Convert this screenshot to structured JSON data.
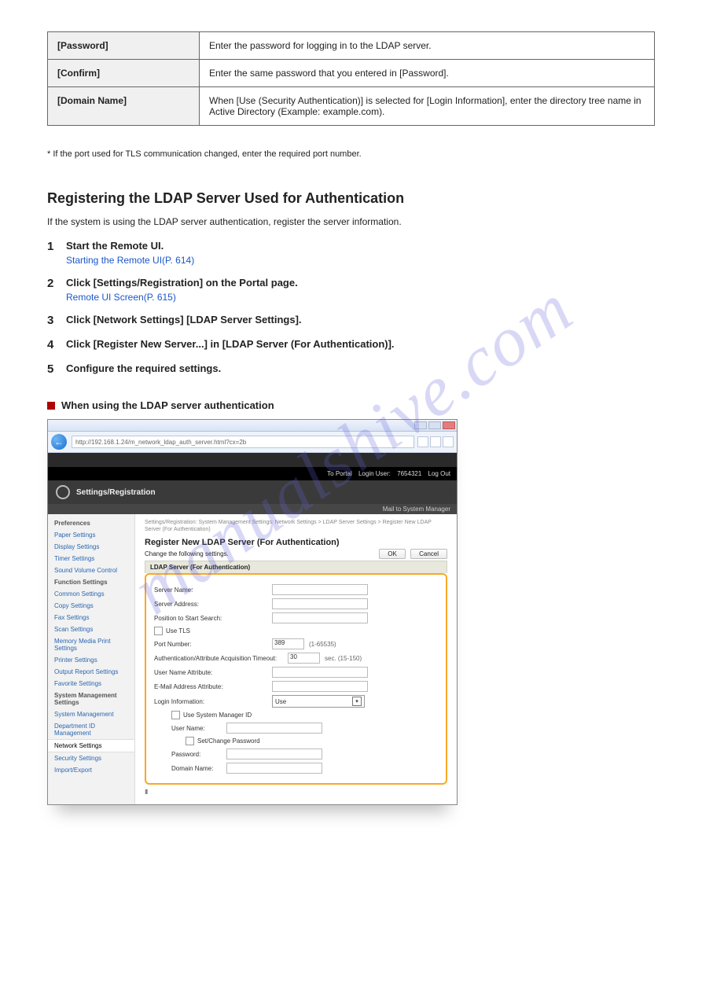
{
  "table_rows": [
    {
      "key": "[Password]",
      "val": "Enter the password for logging in to the LDAP server."
    },
    {
      "key": "[Confirm]",
      "val": "Enter the same password that you entered in [Password]."
    },
    {
      "key": "[Domain Name]",
      "val": "When [Use (Security Authentication)] is selected for [Login Information], enter the directory tree name in Active Directory (Example: example.com)."
    }
  ],
  "footnote": "* If the port used for TLS communication changed, enter the required port number.",
  "auth_heading": "Registering the LDAP Server Used for Authentication",
  "auth_para": "If the system is using the LDAP server authentication, register the server information.",
  "steps": [
    {
      "n": "1",
      "t": "Start the Remote UI.",
      "sub": "Starting the Remote UI(P. 614)",
      "link": true
    },
    {
      "n": "2",
      "t": "Click [Settings/Registration] on the Portal page.",
      "sub": "Remote UI Screen(P. 615)",
      "link": true
    },
    {
      "n": "3",
      "t": "Click [Network Settings]  [LDAP Server Settings]."
    },
    {
      "n": "4",
      "t": "Click [Register New Server...] in [LDAP Server (For Authentication)]."
    },
    {
      "n": "5",
      "t": "Configure the required settings."
    }
  ],
  "subhead": "When using the LDAP server authentication",
  "watermark": "manualshive.com",
  "shot": {
    "url": "http://192.168.1.24/m_network_ldap_auth_server.html?cx=2b",
    "portal": "To Portal",
    "loginuser": "Login User:",
    "user": "7654321",
    "logout": "Log Out",
    "panel": "Settings/Registration",
    "mail": "Mail to System Manager",
    "crumbs": "Settings/Registration: System Management Settings: Network Settings > LDAP Server Settings > Register New LDAP Server (For Authentication)",
    "title": "Register New LDAP Server (For Authentication)",
    "change": "Change the following settings.",
    "ok": "OK",
    "cancel": "Cancel",
    "sec": "LDAP Server (For Authentication)",
    "rows": {
      "srvname": "Server Name:",
      "srvaddr": "Server Address:",
      "pos": "Position to Start Search:",
      "usetls": "Use TLS",
      "port": "Port Number:",
      "portval": "389",
      "portrng": "(1-65535)",
      "timeout": "Authentication/Attribute Acquisition Timeout:",
      "timeoutval": "30",
      "timeoutunit": "sec. (15-150)",
      "una": "User Name Attribute:",
      "ema": "E-Mail Address Attribute:",
      "login": "Login Information:",
      "loginval": "Use",
      "usm": "Use System Manager ID",
      "uname": "User Name:",
      "scp": "Set/Change Password",
      "pwd": "Password:",
      "dom": "Domain Name:"
    },
    "sidebar": [
      {
        "h": "Preferences"
      },
      {
        "i": "Paper Settings"
      },
      {
        "i": "Display Settings"
      },
      {
        "i": "Timer Settings"
      },
      {
        "i": "Sound Volume Control"
      },
      {
        "h": "Function Settings"
      },
      {
        "i": "Common Settings"
      },
      {
        "i": "Copy Settings"
      },
      {
        "i": "Fax Settings"
      },
      {
        "i": "Scan Settings"
      },
      {
        "i": "Memory Media Print Settings"
      },
      {
        "i": "Printer Settings"
      },
      {
        "i": "Output Report Settings"
      },
      {
        "i": "Favorite Settings"
      },
      {
        "h": "System Management Settings"
      },
      {
        "i": "System Management"
      },
      {
        "i": "Department ID Management"
      },
      {
        "i": "Network Settings",
        "active": true
      },
      {
        "i": "Security Settings"
      },
      {
        "i": "Import/Export"
      }
    ]
  }
}
